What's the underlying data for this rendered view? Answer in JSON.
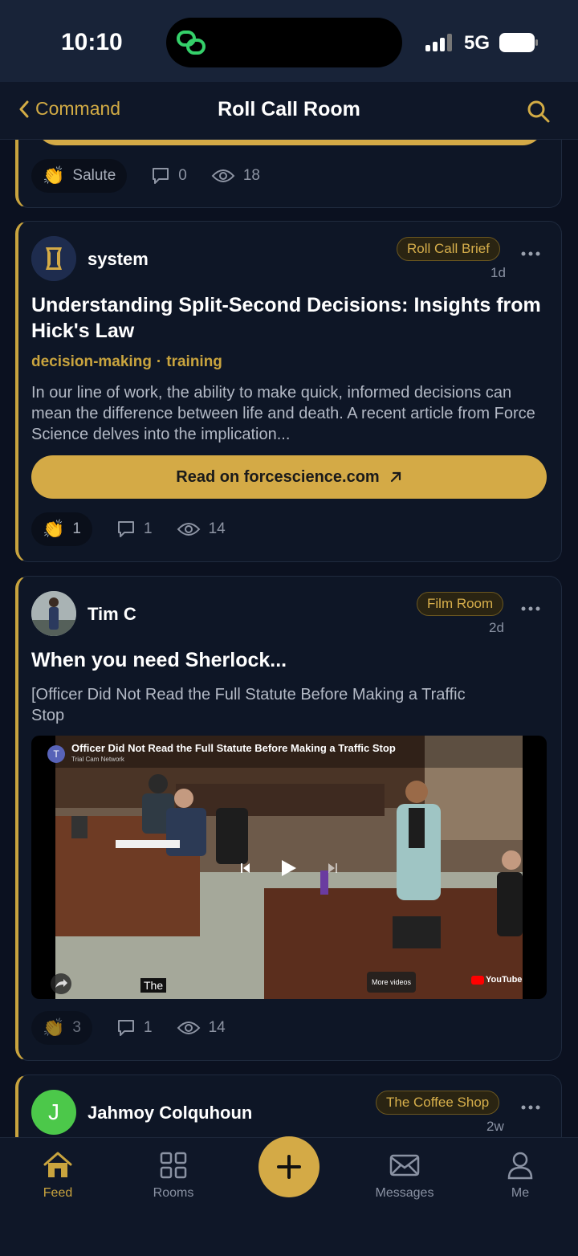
{
  "status_bar": {
    "time": "10:10",
    "network": "5G",
    "signal_icon": "signal-bars-icon",
    "battery_icon": "battery-icon"
  },
  "nav": {
    "back_label": "Command",
    "title": "Roll Call Room",
    "search_icon": "search-icon"
  },
  "prev_post": {
    "salute_label": "Salute",
    "comments": "0",
    "views": "18"
  },
  "posts": [
    {
      "author": "system",
      "badge": "Roll Call Brief",
      "time": "1d",
      "title": "Understanding Split-Second Decisions: Insights from Hick's Law",
      "tags": [
        "decision-making",
        "training"
      ],
      "excerpt": "In our line of work, the ability to make quick, informed decisions can mean the difference between life and death. A recent article from Force Science delves into the implication...",
      "button": "Read on forcescience.com",
      "claps": "1",
      "comments": "1",
      "views": "14"
    },
    {
      "author": "Tim C",
      "badge": "Film Room",
      "time": "2d",
      "title": "When you need Sherlock...",
      "excerpt": "[Officer Did Not Read the Full Statute Before Making a Traffic Stop",
      "video": {
        "title": "Officer Did Not Read the Full Statute Before Making a Traffic Stop",
        "channel": "Trial Cam Network",
        "channel_initial": "T",
        "caption": "The",
        "more_videos": "More videos",
        "brand": "YouTube"
      },
      "claps": "3",
      "comments": "1",
      "views": "14"
    },
    {
      "author": "Jahmoy Colquhoun",
      "avatar_initial": "J",
      "badge": "The Coffee Shop",
      "time": "2w"
    }
  ],
  "tabs": [
    {
      "label": "Feed",
      "icon": "home-icon",
      "active": true
    },
    {
      "label": "Rooms",
      "icon": "grid-icon",
      "active": false
    },
    {
      "label": "Messages",
      "icon": "mail-icon",
      "active": false
    },
    {
      "label": "Me",
      "icon": "person-icon",
      "active": false
    }
  ],
  "fab_icon": "plus-icon",
  "colors": {
    "accent": "#d4aa46",
    "background": "#0b1120",
    "card": "#0e1626"
  }
}
